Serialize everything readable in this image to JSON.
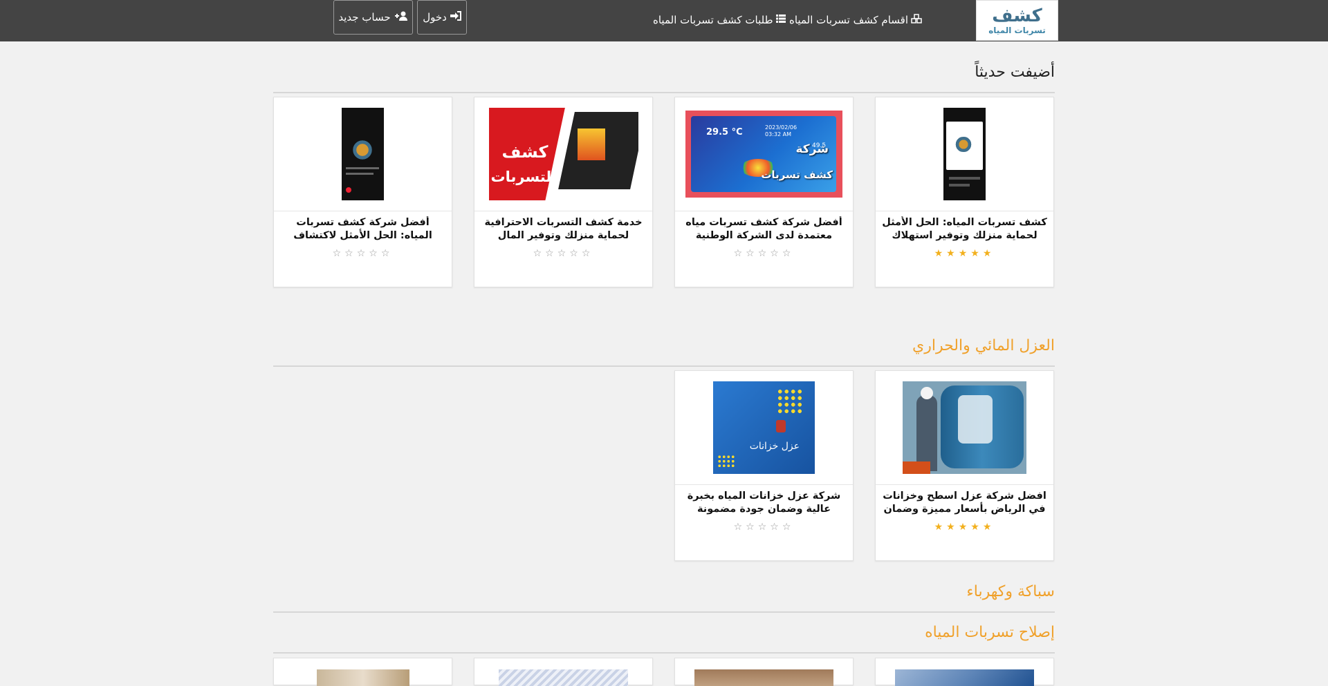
{
  "header": {
    "logo_main": "كشف",
    "logo_sub": "تسربات المياه",
    "nav": [
      {
        "label": "اقسام كشف تسربات المياه",
        "icon": "cubes-icon"
      },
      {
        "label": "طلبات كشف تسربات المياه",
        "icon": "list-icon"
      }
    ],
    "login_label": "دخول",
    "register_label": "حساب جديد"
  },
  "sections": [
    {
      "title": "أضيفت حديثاً",
      "cards": [
        {
          "title": "كشف تسربات المياه: الحل الأمثل لحماية منزلك وتوفير استهلاك المياه",
          "rating": 5,
          "thumb": "phone-logo"
        },
        {
          "title": "أفضل شركة كشف تسربات مياه معتمدة لدى الشركة الوطنية",
          "rating": 0,
          "thumb": "thermal",
          "thumb_text_1": "شركة",
          "thumb_text_2": "كشف تسربات",
          "thumb_temp": "29.5 °C",
          "thumb_date": "2023/02/06",
          "thumb_time": "03:32 AM",
          "thumb_temp2": "49.5"
        },
        {
          "title": "خدمة كشف التسربات الاحترافية لحماية منزلك وتوفير المال",
          "rating": 0,
          "thumb": "red",
          "thumb_text_1": "كشف",
          "thumb_text_2": "التسربات"
        },
        {
          "title": "أفضل شركة كشف تسربات المياه: الحل الأمثل لاكتشاف ومعالجة",
          "rating": 0,
          "thumb": "phone-logo-2"
        }
      ]
    },
    {
      "title": "العزل المائي والحراري",
      "cards": [
        {
          "title": "افضل شركة عزل اسطح وخزانات في الرياض بأسعار مميزة وضمان طويل –",
          "rating": 5,
          "thumb": "tank-worker"
        },
        {
          "title": "شركة عزل خزانات المياه بخبرة عالية وضمان جودة مضمونة",
          "rating": 0,
          "thumb": "blue-tank",
          "thumb_text_1": "عزل خزانات"
        }
      ]
    },
    {
      "title": "سباكة وكهرباء",
      "cards": []
    },
    {
      "title": "إصلاح تسربات المياه",
      "cards": []
    }
  ],
  "colors": {
    "topbar": "#444444",
    "accent_orange": "#f0a12b",
    "star_on": "#f2b01e",
    "star_off": "#9a9a9a"
  }
}
